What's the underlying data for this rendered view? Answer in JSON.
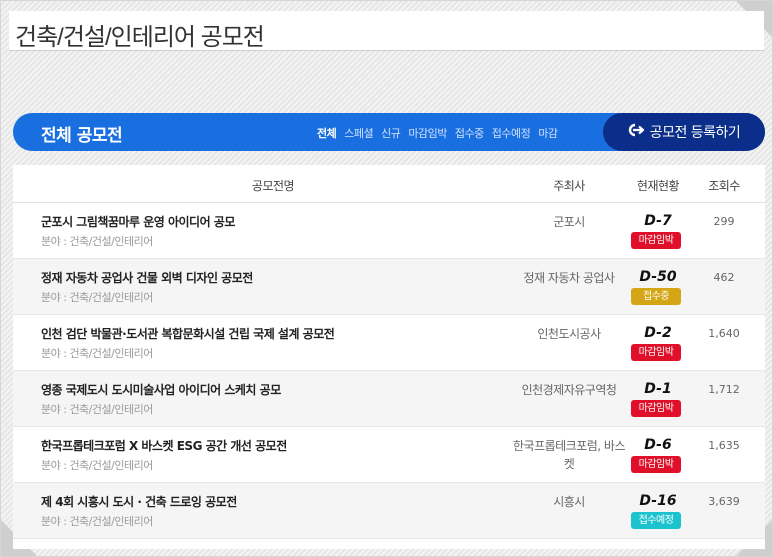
{
  "page": {
    "title": "건축/건설/인테리어 공모전"
  },
  "header": {
    "section_title": "전체 공모전",
    "filters": [
      "전체",
      "스페셜",
      "신규",
      "마감임박",
      "접수중",
      "접수예정",
      "마감"
    ],
    "active_filter": "전체",
    "register_label": "공모전 등록하기",
    "register_icon": "register-arrow-icon"
  },
  "table": {
    "columns": [
      "공모전명",
      "주최사",
      "현재현황",
      "조회수"
    ],
    "rows": [
      {
        "name": "군포시 그림책꿈마루 운영 아이디어 공모",
        "field": "분야 : 건축/건설/인테리어",
        "host": "군포시",
        "dday": "D-7",
        "status": "마감임박",
        "views": "299"
      },
      {
        "name": "정재 자동차 공업사 건물 외벽 디자인 공모전",
        "field": "분야 : 건축/건설/인테리어",
        "host": "정재 자동차 공업사",
        "dday": "D-50",
        "status": "접수중",
        "views": "462"
      },
      {
        "name": "인천 검단 박물관·도서관 복합문화시설 건립 국제 설계 공모전",
        "field": "분야 : 건축/건설/인테리어",
        "host": "인천도시공사",
        "dday": "D-2",
        "status": "마감임박",
        "views": "1,640"
      },
      {
        "name": "영종 국제도시 도시미술사업 아이디어 스케치 공모",
        "field": "분야 : 건축/건설/인테리어",
        "host": "인천경제자유구역청",
        "dday": "D-1",
        "status": "마감임박",
        "views": "1,712"
      },
      {
        "name": "한국프롭테크포럼 X 바스켓 ESG 공간 개선 공모전",
        "field": "분야 : 건축/건설/인테리어",
        "host": "한국프롭테크포럼, 바스켓",
        "dday": "D-6",
        "status": "마감임박",
        "views": "1,635"
      },
      {
        "name": "제 4회 시흥시 도시 · 건축 드로잉 공모전",
        "field": "분야 : 건축/건설/인테리어",
        "host": "시흥시",
        "dday": "D-16",
        "status": "접수예정",
        "views": "3,639"
      }
    ]
  },
  "colors": {
    "accent_blue": "#1a6fe0",
    "register_navy": "#0a2e8a",
    "status_closing": "#e0102a",
    "status_open": "#d4a514",
    "status_upcoming": "#1bc3cf"
  }
}
